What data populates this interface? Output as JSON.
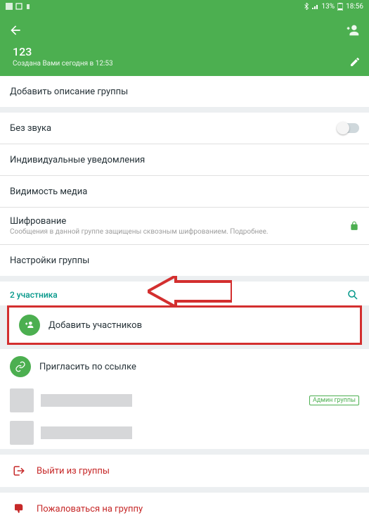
{
  "status": {
    "battery": "13%",
    "time": "18:56"
  },
  "header": {
    "title": "123",
    "subtitle": "Создана Вами сегодня в 12:53"
  },
  "description_row": "Добавить описание группы",
  "mute": {
    "label": "Без звука"
  },
  "custom_notif": {
    "label": "Индивидуальные уведомления"
  },
  "media_vis": {
    "label": "Видимость медиа"
  },
  "encryption": {
    "label": "Шифрование",
    "sub": "Сообщения в данной группе защищены сквозным шифрованием. Подробнее."
  },
  "group_settings": {
    "label": "Настройки группы"
  },
  "participants": {
    "count": "2 участника",
    "add_label": "Добавить участников",
    "invite_label": "Пригласить по ссылке",
    "admin_badge": "Админ группы"
  },
  "exit": {
    "label": "Выйти из группы"
  },
  "report": {
    "label": "Пожаловаться на группу"
  }
}
